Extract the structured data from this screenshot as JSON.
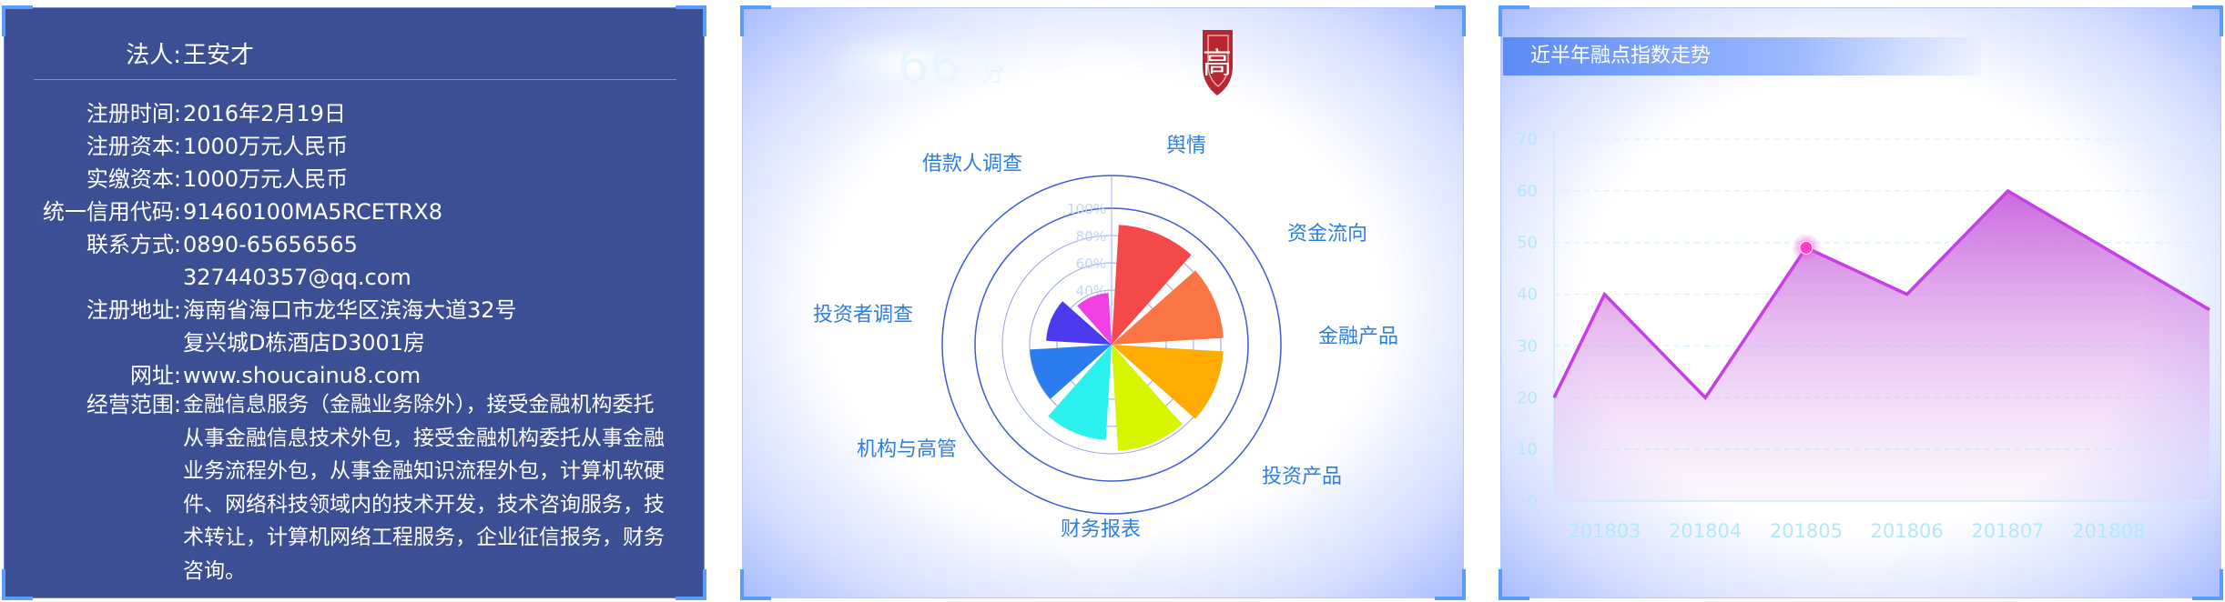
{
  "company": {
    "legal_rep_label": "法人:",
    "legal_rep": "王安才",
    "rows": [
      {
        "label": "注册时间:",
        "value": "2016年2月19日"
      },
      {
        "label": "注册资本:",
        "value": "1000万元人民币"
      },
      {
        "label": "实缴资本:",
        "value": "1000万元人民币"
      },
      {
        "label": "统一信用代码:",
        "value": "91460100MA5RCETRX8"
      },
      {
        "label": "联系方式:",
        "value": "0890-65656565"
      },
      {
        "label": "",
        "value": "327440357@qq.com"
      },
      {
        "label": "注册地址:",
        "value": "海南省海口市龙华区滨海大道32号"
      },
      {
        "label": "",
        "value": "复兴城D栋酒店D3001房"
      },
      {
        "label": "网址:",
        "value": "www.shoucainu8.com"
      }
    ],
    "scope_label": "经营范围:",
    "scope": "金融信息服务（金融业务除外），接受金融机构委托从事金融信息技术外包，接受金融机构委托从事金融业务流程外包，从事金融知识流程外包，计算机软硬件、网络科技领域内的技术开发，技术咨询服务，技术转让，计算机网络工程服务，企业征信报务，财务咨询。"
  },
  "score": {
    "value": "66",
    "unit": "分",
    "risk_badge": "高",
    "badge_color": "#b8262f"
  },
  "chart_data": [
    {
      "type": "bar",
      "subtype": "polar-rose",
      "categories": [
        "舆情",
        "资金流向",
        "金融产品",
        "投资产品",
        "财务报表",
        "机构与高管",
        "投资者调查",
        "借款人调查"
      ],
      "values": [
        88,
        82,
        82,
        78,
        70,
        60,
        48,
        38
      ],
      "colors": [
        "#f5484a",
        "#fb7443",
        "#ffab00",
        "#d8f500",
        "#2af1ee",
        "#2b7cf1",
        "#4c3af0",
        "#f040e3"
      ],
      "radial_ticks": [
        "40%",
        "60%",
        "80%",
        "100%"
      ],
      "rlim": [
        0,
        100
      ]
    },
    {
      "type": "area",
      "title": "近半年融点指数走势",
      "categories": [
        "201803",
        "201804",
        "201805",
        "201806",
        "201807",
        "201808"
      ],
      "x": [
        0,
        0.5,
        1.5,
        2.5,
        3.5,
        4.5,
        5.5,
        6.5
      ],
      "values": [
        20,
        40,
        20,
        49,
        40,
        60,
        37
      ],
      "ylim": [
        0,
        70
      ],
      "yticks": [
        0,
        10,
        20,
        30,
        40,
        50,
        60,
        70
      ],
      "highlight_index": 3,
      "line_color": "#c63ee8",
      "grid": true
    }
  ]
}
